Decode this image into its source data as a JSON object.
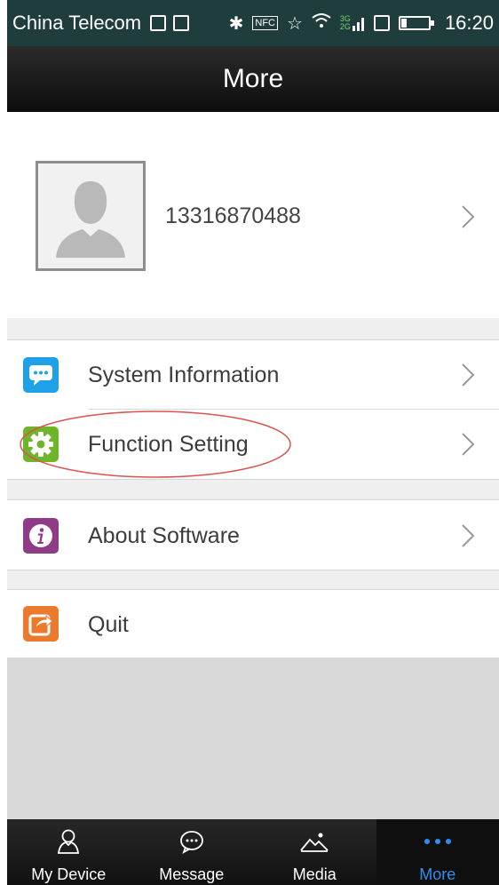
{
  "status_bar": {
    "carrier": "China Telecom",
    "time": "16:20",
    "icons_left": [
      "gallery-notification-icon",
      "image-notification-icon"
    ],
    "icons_right": [
      "bluetooth-icon",
      "nfc-icon",
      "vibrate-icon",
      "wifi-icon",
      "signal-icon",
      "sim-icon",
      "battery-icon"
    ],
    "network_labels": [
      "3G",
      "2G"
    ],
    "nfc_label": "NFC"
  },
  "header": {
    "title": "More"
  },
  "profile": {
    "phone_number": "13316870488",
    "avatar_icon": "avatar-placeholder-icon"
  },
  "menu": {
    "system_information": {
      "label": "System Information",
      "icon": "chat-bubble-icon",
      "color": "#1ea1e6"
    },
    "function_setting": {
      "label": "Function Setting",
      "icon": "gear-icon",
      "color": "#6fb52c"
    },
    "about_software": {
      "label": "About Software",
      "icon": "info-icon",
      "color": "#8f3b87"
    },
    "quit": {
      "label": "Quit",
      "icon": "exit-share-icon",
      "color": "#ea7a2d"
    }
  },
  "annotation": {
    "color": "#d9534f",
    "target": "function_setting"
  },
  "tabs": [
    {
      "label": "My Device",
      "icon": "person-icon",
      "active": false
    },
    {
      "label": "Message",
      "icon": "message-icon",
      "active": false
    },
    {
      "label": "Media",
      "icon": "landscape-icon",
      "active": false
    },
    {
      "label": "More",
      "icon": "more-dots-icon",
      "active": true
    }
  ],
  "colors": {
    "active_tab": "#2e8ef0",
    "header_bg": "#1a1a1a",
    "status_bar_bg": "#1f3d3c"
  }
}
